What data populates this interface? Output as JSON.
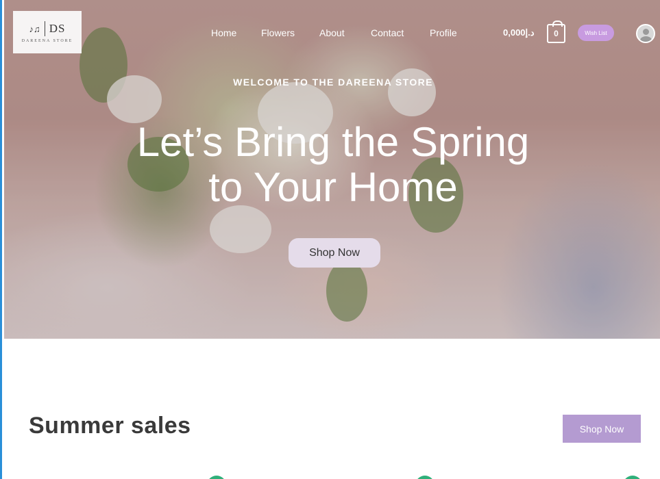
{
  "logo": {
    "mark": "♪♫",
    "initials": "DS",
    "subtitle": "DAREENA STORE"
  },
  "nav": {
    "items": [
      "Home",
      "Flowers",
      "About",
      "Contact",
      "Profile"
    ]
  },
  "header": {
    "price": "د.إ0,000",
    "cart_count": "0",
    "wishlist_label": "Wish List"
  },
  "hero": {
    "welcome": "WELCOME TO THE DAREENA STORE",
    "headline_line1": "Let’s Bring the Spring",
    "headline_line2": "to Your Home",
    "cta": "Shop Now"
  },
  "sales": {
    "title": "Summer sales",
    "cta": "Shop Now"
  },
  "colors": {
    "accent": "#b49bd1",
    "wishlist": "#c89be0",
    "badge_green": "#2fb07a",
    "frame_border": "#2a8fd8"
  }
}
